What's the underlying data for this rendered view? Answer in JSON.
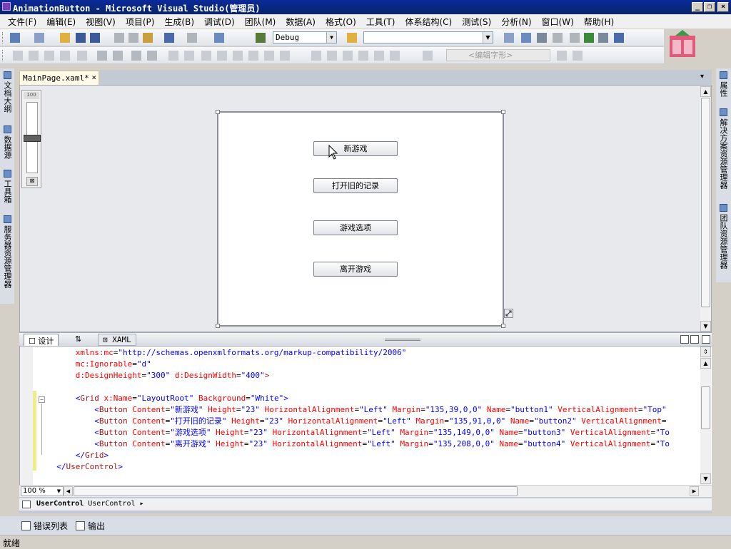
{
  "window": {
    "title": "AnimationButton - Microsoft Visual Studio(管理员)"
  },
  "menu": [
    "文件(F)",
    "编辑(E)",
    "视图(V)",
    "项目(P)",
    "生成(B)",
    "调试(D)",
    "团队(M)",
    "数据(A)",
    "格式(O)",
    "工具(T)",
    "体系结构(C)",
    "测试(S)",
    "分析(N)",
    "窗口(W)",
    "帮助(H)"
  ],
  "toolbar": {
    "configuration": "Debug",
    "platform": "",
    "font_placeholder": "<编辑字形>"
  },
  "left_dock": [
    "文档大纲",
    "数据源",
    "工具箱",
    "服务器资源管理器"
  ],
  "right_dock": [
    "属性",
    "解决方案资源管理器",
    "团队资源管理器"
  ],
  "document": {
    "tab_label": "MainPage.xaml*",
    "close_glyph": "×"
  },
  "designer": {
    "zoom_slider_label": "100",
    "buttons": [
      "新游戏",
      "打开旧的记录",
      "游戏选项",
      "离开游戏"
    ]
  },
  "split": {
    "design_tab": "设计",
    "swap_glyph": "⇅",
    "xaml_tab": "XAML"
  },
  "code": [
    {
      "indent": "      ",
      "parts": [
        [
          "at",
          "xmlns:mc"
        ],
        [
          "tx",
          "="
        ],
        [
          "vl",
          "\"http://schemas.openxmlformats.org/markup-compatibility/2006\""
        ]
      ]
    },
    {
      "indent": "      ",
      "parts": [
        [
          "at",
          "mc:Ignorable"
        ],
        [
          "tx",
          "="
        ],
        [
          "vl",
          "\"d\""
        ]
      ]
    },
    {
      "indent": "      ",
      "parts": [
        [
          "at",
          "d:DesignHeight"
        ],
        [
          "tx",
          "="
        ],
        [
          "vl",
          "\"300\""
        ],
        [
          "tx",
          " "
        ],
        [
          "at",
          "d:DesignWidth"
        ],
        [
          "tx",
          "="
        ],
        [
          "vl",
          "\"400\""
        ],
        [
          "kw",
          ">"
        ]
      ]
    },
    {
      "indent": "",
      "parts": []
    },
    {
      "indent": "      ",
      "parts": [
        [
          "vl",
          "<"
        ],
        [
          "kw",
          "Grid"
        ],
        [
          "tx",
          " "
        ],
        [
          "at",
          "x:Name"
        ],
        [
          "tx",
          "="
        ],
        [
          "vl",
          "\"LayoutRoot\""
        ],
        [
          "tx",
          " "
        ],
        [
          "at",
          "Background"
        ],
        [
          "tx",
          "="
        ],
        [
          "vl",
          "\"White\""
        ],
        [
          "vl",
          ">"
        ]
      ]
    },
    {
      "indent": "          ",
      "parts": [
        [
          "vl",
          "<"
        ],
        [
          "kw",
          "Button"
        ],
        [
          "tx",
          " "
        ],
        [
          "at",
          "Content"
        ],
        [
          "tx",
          "="
        ],
        [
          "vl",
          "\"新游戏\""
        ],
        [
          "tx",
          " "
        ],
        [
          "at",
          "Height"
        ],
        [
          "tx",
          "="
        ],
        [
          "vl",
          "\"23\""
        ],
        [
          "tx",
          " "
        ],
        [
          "at",
          "HorizontalAlignment"
        ],
        [
          "tx",
          "="
        ],
        [
          "vl",
          "\"Left\""
        ],
        [
          "tx",
          " "
        ],
        [
          "at",
          "Margin"
        ],
        [
          "tx",
          "="
        ],
        [
          "vl",
          "\"135,39,0,0\""
        ],
        [
          "tx",
          " "
        ],
        [
          "at",
          "Name"
        ],
        [
          "tx",
          "="
        ],
        [
          "vl",
          "\"button1\""
        ],
        [
          "tx",
          " "
        ],
        [
          "at",
          "VerticalAlignment"
        ],
        [
          "tx",
          "="
        ],
        [
          "vl",
          "\"Top\""
        ]
      ]
    },
    {
      "indent": "          ",
      "parts": [
        [
          "vl",
          "<"
        ],
        [
          "kw",
          "Button"
        ],
        [
          "tx",
          " "
        ],
        [
          "at",
          "Content"
        ],
        [
          "tx",
          "="
        ],
        [
          "vl",
          "\"打开旧的记录\""
        ],
        [
          "tx",
          " "
        ],
        [
          "at",
          "Height"
        ],
        [
          "tx",
          "="
        ],
        [
          "vl",
          "\"23\""
        ],
        [
          "tx",
          " "
        ],
        [
          "at",
          "HorizontalAlignment"
        ],
        [
          "tx",
          "="
        ],
        [
          "vl",
          "\"Left\""
        ],
        [
          "tx",
          " "
        ],
        [
          "at",
          "Margin"
        ],
        [
          "tx",
          "="
        ],
        [
          "vl",
          "\"135,91,0,0\""
        ],
        [
          "tx",
          " "
        ],
        [
          "at",
          "Name"
        ],
        [
          "tx",
          "="
        ],
        [
          "vl",
          "\"button2\""
        ],
        [
          "tx",
          " "
        ],
        [
          "at",
          "VerticalAlignment"
        ],
        [
          "tx",
          "="
        ]
      ]
    },
    {
      "indent": "          ",
      "parts": [
        [
          "vl",
          "<"
        ],
        [
          "kw",
          "Button"
        ],
        [
          "tx",
          " "
        ],
        [
          "at",
          "Content"
        ],
        [
          "tx",
          "="
        ],
        [
          "vl",
          "\"游戏选项\""
        ],
        [
          "tx",
          " "
        ],
        [
          "at",
          "Height"
        ],
        [
          "tx",
          "="
        ],
        [
          "vl",
          "\"23\""
        ],
        [
          "tx",
          " "
        ],
        [
          "at",
          "HorizontalAlignment"
        ],
        [
          "tx",
          "="
        ],
        [
          "vl",
          "\"Left\""
        ],
        [
          "tx",
          " "
        ],
        [
          "at",
          "Margin"
        ],
        [
          "tx",
          "="
        ],
        [
          "vl",
          "\"135,149,0,0\""
        ],
        [
          "tx",
          " "
        ],
        [
          "at",
          "Name"
        ],
        [
          "tx",
          "="
        ],
        [
          "vl",
          "\"button3\""
        ],
        [
          "tx",
          " "
        ],
        [
          "at",
          "VerticalAlignment"
        ],
        [
          "tx",
          "="
        ],
        [
          "vl",
          "\"To"
        ]
      ]
    },
    {
      "indent": "          ",
      "parts": [
        [
          "vl",
          "<"
        ],
        [
          "kw",
          "Button"
        ],
        [
          "tx",
          " "
        ],
        [
          "at",
          "Content"
        ],
        [
          "tx",
          "="
        ],
        [
          "vl",
          "\"离开游戏\""
        ],
        [
          "tx",
          " "
        ],
        [
          "at",
          "Height"
        ],
        [
          "tx",
          "="
        ],
        [
          "vl",
          "\"23\""
        ],
        [
          "tx",
          " "
        ],
        [
          "at",
          "HorizontalAlignment"
        ],
        [
          "tx",
          "="
        ],
        [
          "vl",
          "\"Left\""
        ],
        [
          "tx",
          " "
        ],
        [
          "at",
          "Margin"
        ],
        [
          "tx",
          "="
        ],
        [
          "vl",
          "\"135,208,0,0\""
        ],
        [
          "tx",
          " "
        ],
        [
          "at",
          "Name"
        ],
        [
          "tx",
          "="
        ],
        [
          "vl",
          "\"button4\""
        ],
        [
          "tx",
          " "
        ],
        [
          "at",
          "VerticalAlignment"
        ],
        [
          "tx",
          "="
        ],
        [
          "vl",
          "\"To"
        ]
      ]
    },
    {
      "indent": "      ",
      "parts": [
        [
          "vl",
          "</"
        ],
        [
          "kw",
          "Grid"
        ],
        [
          "vl",
          ">"
        ]
      ]
    },
    {
      "indent": "  ",
      "parts": [
        [
          "vl",
          "</"
        ],
        [
          "kw",
          "UserControl"
        ],
        [
          "vl",
          ">"
        ]
      ]
    }
  ],
  "editor": {
    "zoom": "100 %"
  },
  "breadcrumb": {
    "element": "UserControl",
    "type": "UserControl",
    "arrow": "▸"
  },
  "bottom_tabs": [
    "错误列表",
    "输出"
  ],
  "status": "就绪",
  "colors": {
    "title_bar": "#0a246a",
    "keyword": "#a31515",
    "attribute": "#ff0000",
    "value": "#0000ff"
  }
}
